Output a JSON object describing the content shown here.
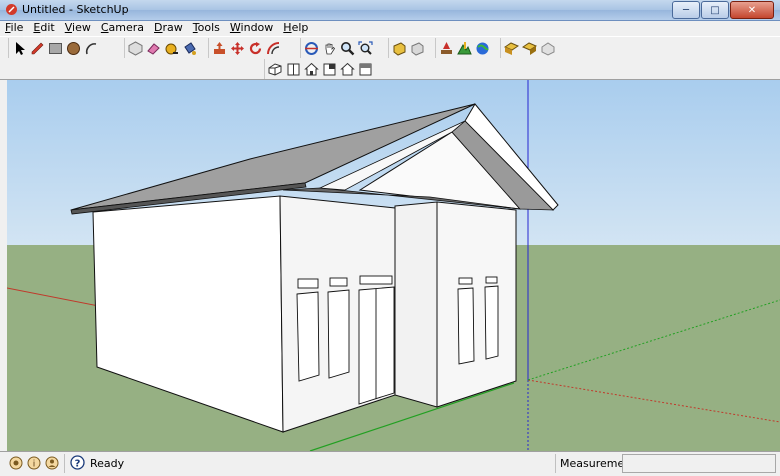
{
  "window": {
    "title": "Untitled - SketchUp"
  },
  "menu": [
    "File",
    "Edit",
    "View",
    "Camera",
    "Draw",
    "Tools",
    "Window",
    "Help"
  ],
  "toolbar": {
    "tools": [
      "select",
      "pencil",
      "rectangle",
      "circle",
      "arc",
      "make-component",
      "eraser",
      "tape-measure",
      "paint-bucket",
      "push-pull",
      "move",
      "rotate",
      "offset",
      "orbit",
      "pan",
      "zoom",
      "zoom-extents",
      "get-models",
      "share-model",
      "add-location",
      "google-earth",
      "get-photo-texture",
      "share-component",
      "place-model"
    ]
  },
  "views_toolbar": {
    "views": [
      "iso",
      "top",
      "front",
      "right",
      "back",
      "left"
    ]
  },
  "status": {
    "text": "Ready",
    "measurements_label": "Measurements",
    "measurements_value": ""
  },
  "colors": {
    "sky": "#b6d3ec",
    "ground": "#96b083",
    "red_axis": "#c0392b",
    "green_axis": "#22a022",
    "blue_axis": "#2222cc"
  }
}
